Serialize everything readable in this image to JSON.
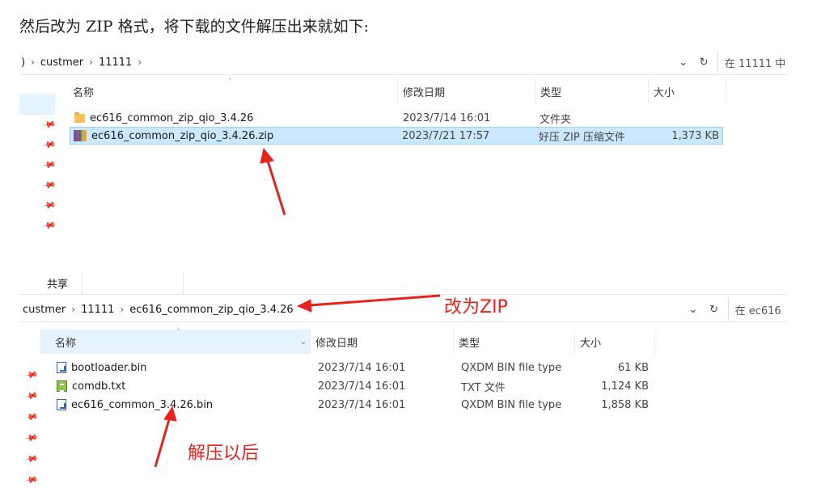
{
  "intro_text": "然后改为 ZIP 格式，将下载的文件解压出来就如下:",
  "explorer1": {
    "breadcrumb": [
      ")",
      "custmer",
      "11111"
    ],
    "search_placeholder": "在 11111 中",
    "columns": {
      "name": "名称",
      "modified": "修改日期",
      "type": "类型",
      "size": "大小"
    },
    "rows": [
      {
        "name": "ec616_common_zip_qio_3.4.26",
        "modified": "2023/7/14 16:01",
        "type": "文件夹",
        "size": "",
        "icon": "folder-icon"
      },
      {
        "name": "ec616_common_zip_qio_3.4.26.zip",
        "modified": "2023/7/21 17:57",
        "type": "好压 ZIP 压缩文件",
        "size": "1,373 KB",
        "icon": "zip-archive-icon",
        "selected": true
      }
    ]
  },
  "explorer2": {
    "ribbon_tab": "共享",
    "breadcrumb": [
      "custmer",
      "11111",
      "ec616_common_zip_qio_3.4.26"
    ],
    "search_placeholder": "在 ec616",
    "columns": {
      "name": "名称",
      "modified": "修改日期",
      "type": "类型",
      "size": "大小"
    },
    "rows": [
      {
        "name": "bootloader.bin",
        "modified": "2023/7/14 16:01",
        "type": "QXDM BIN file type",
        "size": "61 KB",
        "icon": "bin-file-icon"
      },
      {
        "name": "comdb.txt",
        "modified": "2023/7/14 16:01",
        "type": "TXT 文件",
        "size": "1,124 KB",
        "icon": "txt-file-icon"
      },
      {
        "name": "ec616_common_3.4.26.bin",
        "modified": "2023/7/14 16:01",
        "type": "QXDM BIN file type",
        "size": "1,858 KB",
        "icon": "bin-file-icon"
      }
    ]
  },
  "annotations": {
    "change_to_zip": "改为ZIP",
    "after_extract": "解压以后",
    "color": "#e8231f"
  }
}
